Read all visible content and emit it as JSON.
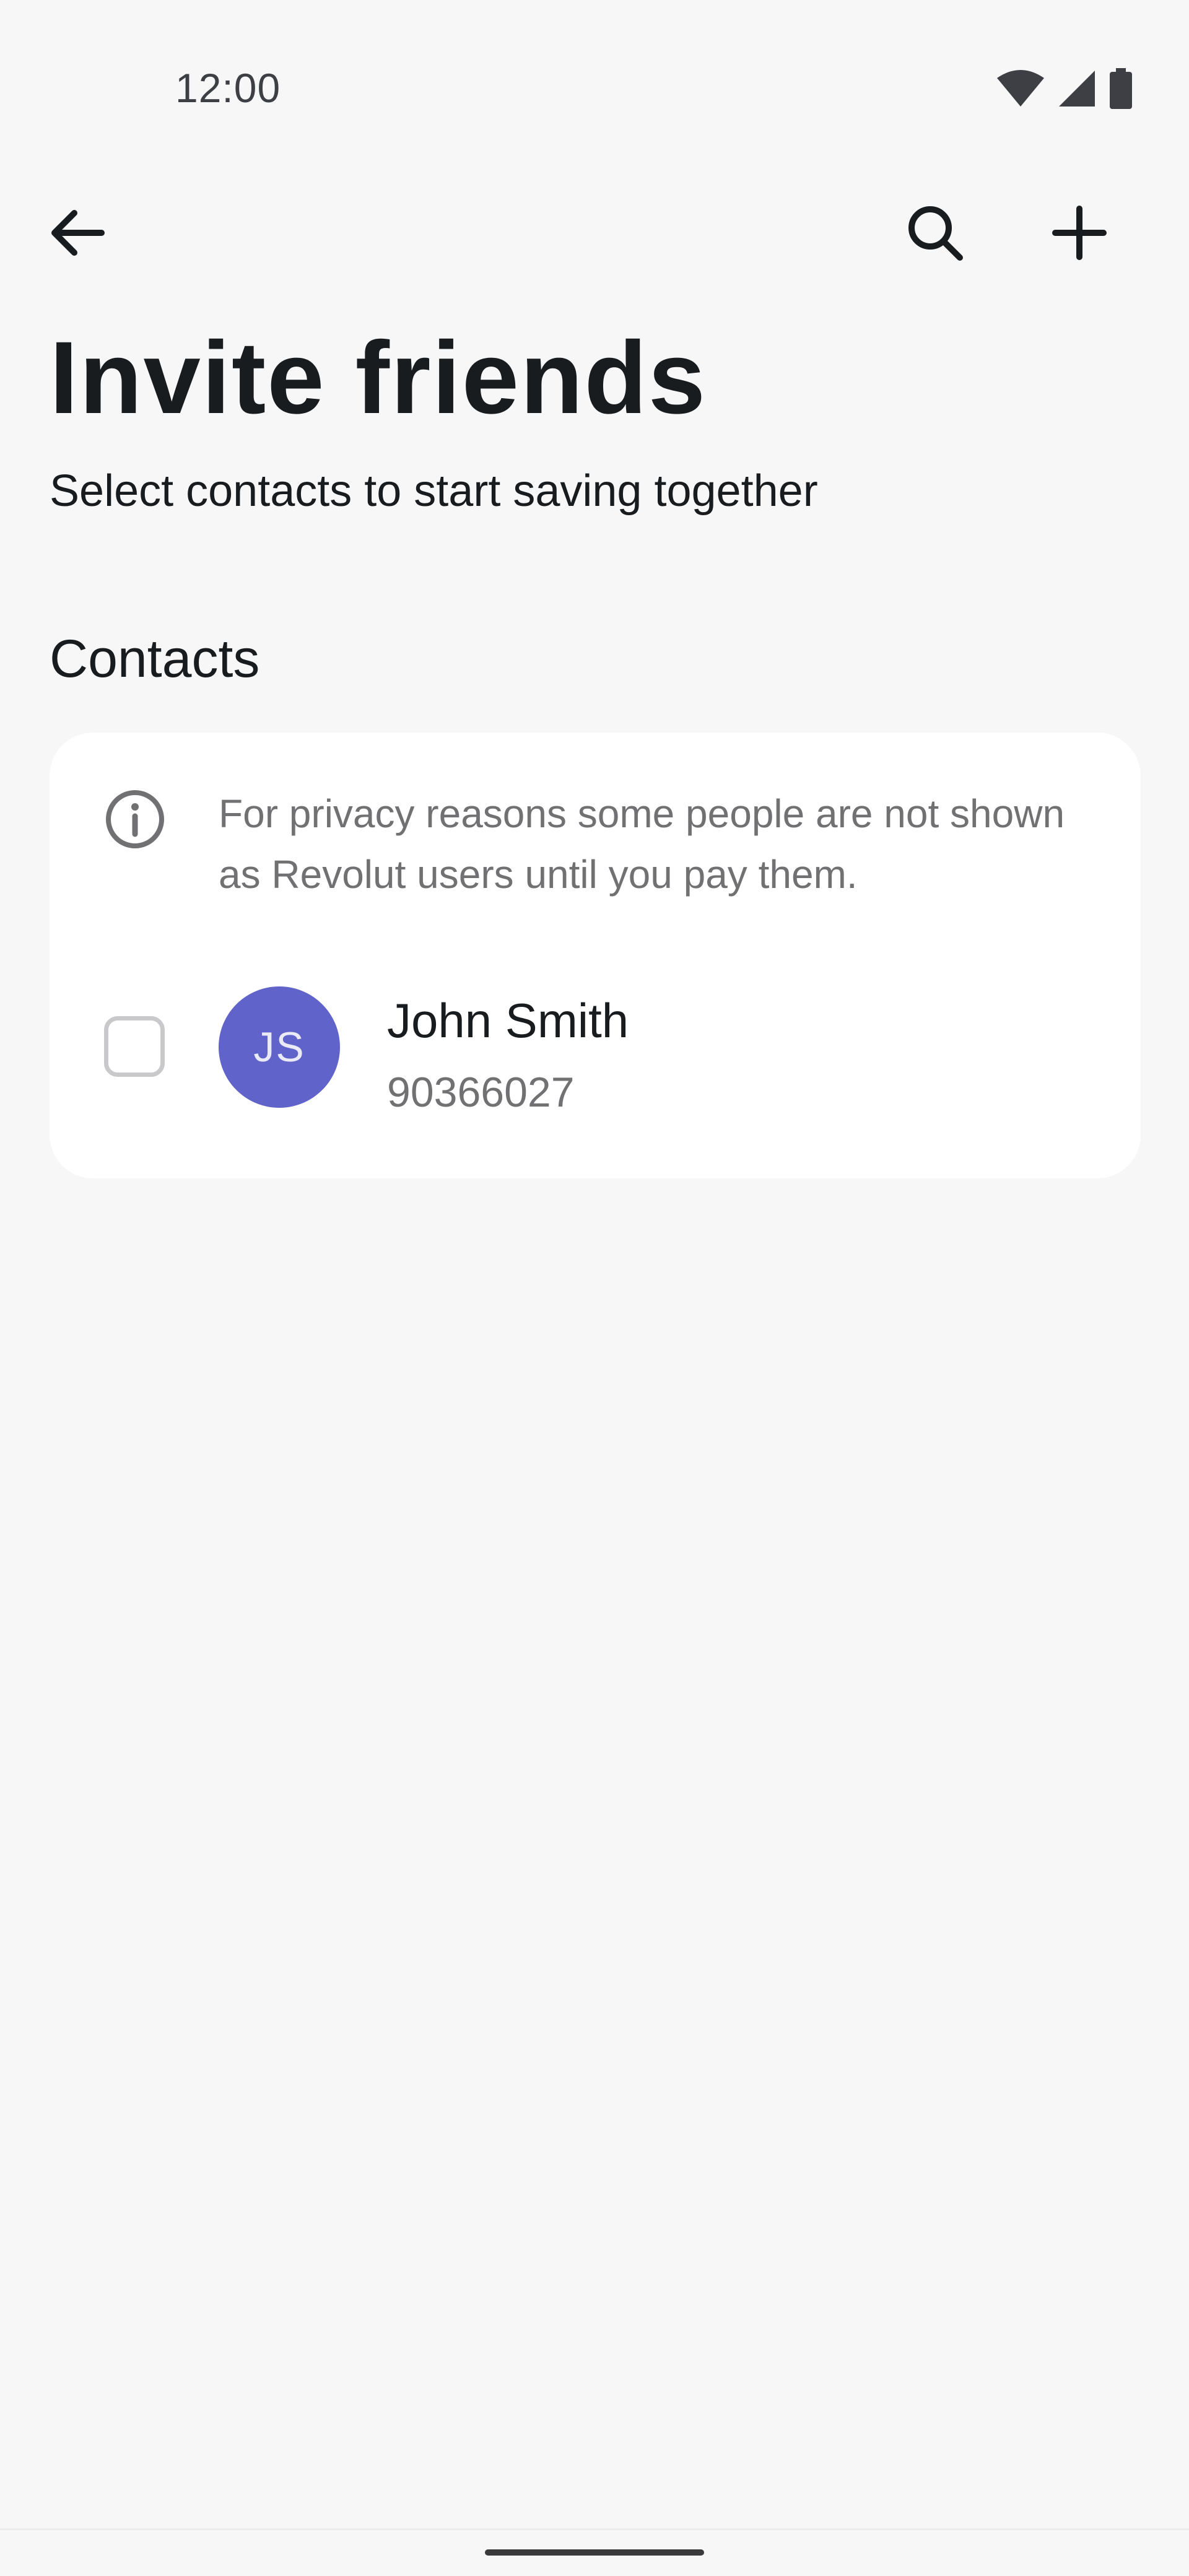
{
  "status_bar": {
    "time": "12:00",
    "icons": [
      "wifi-icon",
      "cellular-signal-icon",
      "battery-icon"
    ]
  },
  "app_bar": {
    "icons": [
      "back-arrow-icon",
      "search-icon",
      "plus-icon"
    ]
  },
  "header": {
    "title": "Invite friends",
    "subtitle": "Select contacts to start saving together"
  },
  "contacts": {
    "heading": "Contacts",
    "info_text": "For privacy reasons some people are not shown as Revolut users until you pay them.",
    "items": [
      {
        "initials": "JS",
        "name": "John Smith",
        "phone": "90366027",
        "selected": false,
        "avatar_color": "#6063c9"
      }
    ]
  },
  "colors": {
    "background": "#f7f7f8",
    "card": "#ffffff",
    "primary_text": "#191c1f",
    "secondary_text": "#717173",
    "avatar": "#6063c9"
  }
}
